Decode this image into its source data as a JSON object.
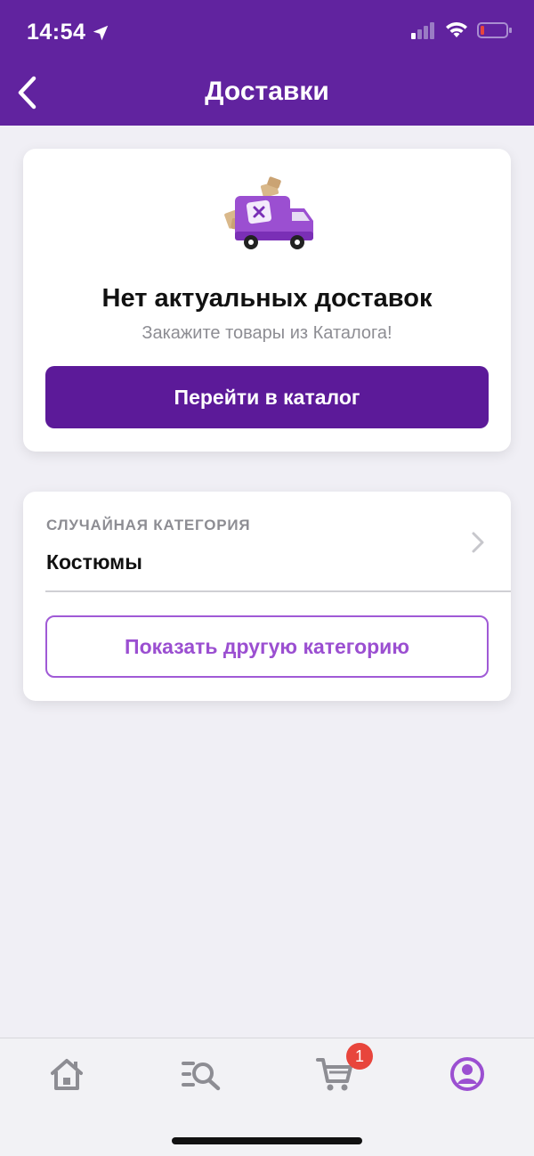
{
  "status_bar": {
    "time": "14:54"
  },
  "header": {
    "title": "Доставки"
  },
  "empty_state": {
    "title": "Нет актуальных доставок",
    "subtitle": "Закажите товары из Каталога!",
    "button_label": "Перейти в каталог"
  },
  "random_category": {
    "label": "СЛУЧАЙНАЯ КАТЕГОРИЯ",
    "value": "Костюмы",
    "button_label": "Показать другую категорию"
  },
  "tabbar": {
    "items": [
      {
        "icon": "home-icon"
      },
      {
        "icon": "catalog-search-icon"
      },
      {
        "icon": "cart-icon"
      },
      {
        "icon": "profile-icon"
      }
    ],
    "cart_badge": "1"
  },
  "colors": {
    "header": "#61239f",
    "primary": "#5c1a99",
    "accent": "#9b4fd1",
    "badge": "#e8453c"
  }
}
